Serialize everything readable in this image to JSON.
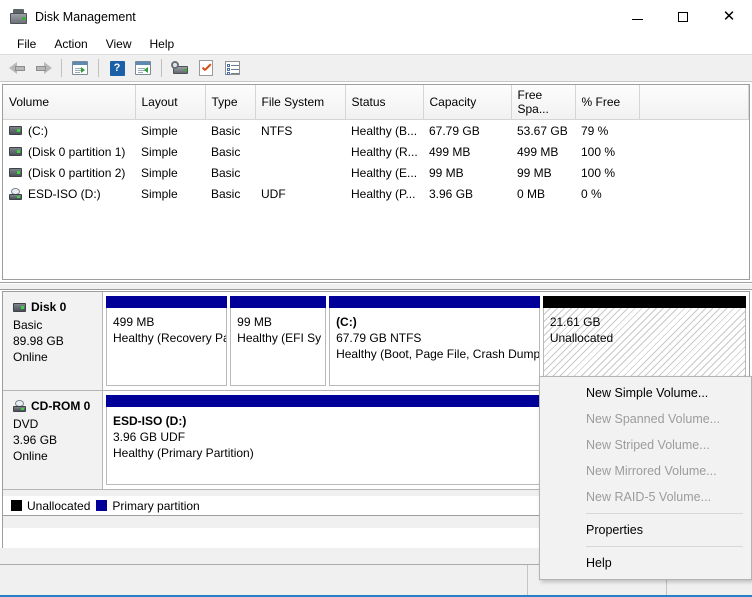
{
  "window": {
    "title": "Disk Management",
    "icon": "disk-management-icon",
    "controls": {
      "minimize": "–",
      "maximize": "☐",
      "close": "✕"
    }
  },
  "menubar": {
    "items": [
      "File",
      "Action",
      "View",
      "Help"
    ]
  },
  "toolbar": {
    "items": [
      {
        "name": "back-icon",
        "label": "Back"
      },
      {
        "name": "forward-icon",
        "label": "Forward"
      },
      {
        "name": "show-hide-console-tree-icon",
        "label": "Show/Hide Console Tree"
      },
      {
        "name": "help-icon",
        "label": "Help"
      },
      {
        "name": "show-hide-action-pane-icon",
        "label": "Show/Hide Action Pane"
      },
      {
        "name": "rescan-disks-icon",
        "label": "Rescan Disks"
      },
      {
        "name": "properties-icon",
        "label": "Properties"
      },
      {
        "name": "list-view-icon",
        "label": "List View"
      }
    ]
  },
  "volume_list": {
    "columns": [
      "Volume",
      "Layout",
      "Type",
      "File System",
      "Status",
      "Capacity",
      "Free Spa...",
      "% Free"
    ],
    "rows": [
      {
        "icon": "hard-disk-icon",
        "volume": "(C:)",
        "layout": "Simple",
        "type": "Basic",
        "file_system": "NTFS",
        "status": "Healthy (B...",
        "capacity": "67.79 GB",
        "free_space": "53.67 GB",
        "percent_free": "79 %"
      },
      {
        "icon": "hard-disk-icon",
        "volume": "(Disk 0 partition 1)",
        "layout": "Simple",
        "type": "Basic",
        "file_system": "",
        "status": "Healthy (R...",
        "capacity": "499 MB",
        "free_space": "499 MB",
        "percent_free": "100 %"
      },
      {
        "icon": "hard-disk-icon",
        "volume": "(Disk 0 partition 2)",
        "layout": "Simple",
        "type": "Basic",
        "file_system": "",
        "status": "Healthy (E...",
        "capacity": "99 MB",
        "free_space": "99 MB",
        "percent_free": "100 %"
      },
      {
        "icon": "cd-drive-icon",
        "volume": "ESD-ISO (D:)",
        "layout": "Simple",
        "type": "Basic",
        "file_system": "UDF",
        "status": "Healthy (P...",
        "capacity": "3.96 GB",
        "free_space": "0 MB",
        "percent_free": "0 %"
      }
    ]
  },
  "graphical_view": {
    "disks": [
      {
        "icon": "hard-disk-icon",
        "name": "Disk 0",
        "type": "Basic",
        "size": "89.98 GB",
        "state": "Online",
        "partitions": [
          {
            "kind": "primary",
            "label": "",
            "size_line": "499 MB",
            "status_line": "Healthy (Recovery Pą",
            "width_pct": 19.2
          },
          {
            "kind": "primary",
            "label": "",
            "size_line": "99 MB",
            "status_line": "Healthy (EFI Sy",
            "width_pct": 15.2
          },
          {
            "kind": "primary",
            "label": "(C:)",
            "size_line": "67.79 GB NTFS",
            "status_line": "Healthy (Boot, Page File, Crash Dump, F",
            "width_pct": 33.4
          },
          {
            "kind": "unallocated",
            "label": "",
            "size_line": "21.61 GB",
            "status_line": "Unallocated",
            "width_pct": 32.2
          }
        ]
      },
      {
        "icon": "cd-drive-icon",
        "name": "CD-ROM 0",
        "type": "DVD",
        "size": "3.96 GB",
        "state": "Online",
        "partitions": [
          {
            "kind": "primary",
            "label": "ESD-ISO  (D:)",
            "size_line": "3.96 GB UDF",
            "status_line": "Healthy (Primary Partition)",
            "width_pct": 100
          }
        ]
      }
    ]
  },
  "context_menu": {
    "items": [
      {
        "label": "New Simple Volume...",
        "enabled": true,
        "separator_after": false
      },
      {
        "label": "New Spanned Volume...",
        "enabled": false,
        "separator_after": false
      },
      {
        "label": "New Striped Volume...",
        "enabled": false,
        "separator_after": false
      },
      {
        "label": "New Mirrored Volume...",
        "enabled": false,
        "separator_after": false
      },
      {
        "label": "New RAID-5 Volume...",
        "enabled": false,
        "separator_after": true
      },
      {
        "label": "Properties",
        "enabled": true,
        "separator_after": true
      },
      {
        "label": "Help",
        "enabled": true,
        "separator_after": false
      }
    ]
  },
  "legend": {
    "items": [
      {
        "label": "Unallocated",
        "color": "#000000"
      },
      {
        "label": "Primary partition",
        "color": "#000099"
      }
    ]
  },
  "status_bar": {
    "segments": [
      "",
      "",
      ""
    ]
  },
  "colors": {
    "primary_partition": "#000099",
    "unallocated": "#000000",
    "accent_border": "#2a7fc9",
    "help_icon_bg": "#1b5fa8"
  }
}
